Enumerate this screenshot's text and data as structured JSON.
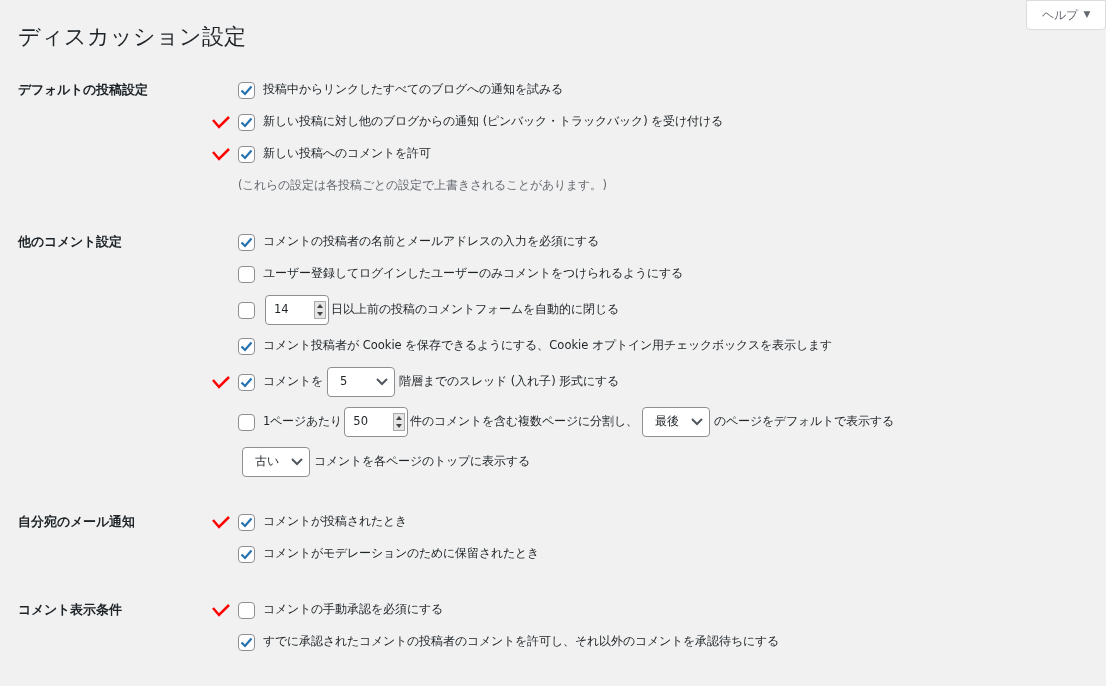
{
  "help_tab": {
    "label": "ヘルプ",
    "arrow": "▼"
  },
  "title": "ディスカッション設定",
  "sections": [
    {
      "label": "デフォルトの投稿設定",
      "rows": [
        {
          "kind": "checkbox",
          "checked": true,
          "marked": false,
          "parts": [
            {
              "kind": "text",
              "text": "投稿中からリンクしたすべてのブログへの通知を試みる"
            }
          ]
        },
        {
          "kind": "checkbox",
          "checked": true,
          "marked": true,
          "parts": [
            {
              "kind": "text",
              "text": "新しい投稿に対し他のブログからの通知 (ピンバック・トラックバック) を受け付ける"
            }
          ]
        },
        {
          "kind": "checkbox",
          "checked": true,
          "marked": true,
          "parts": [
            {
              "kind": "text",
              "text": "新しい投稿へのコメントを許可"
            }
          ]
        },
        {
          "kind": "note",
          "marked": false,
          "parts": [
            {
              "kind": "text",
              "text": "(これらの設定は各投稿ごとの設定で上書きされることがあります。)"
            }
          ]
        }
      ]
    },
    {
      "label": "他のコメント設定",
      "rows": [
        {
          "kind": "checkbox",
          "checked": true,
          "marked": false,
          "parts": [
            {
              "kind": "text",
              "text": "コメントの投稿者の名前とメールアドレスの入力を必須にする"
            }
          ]
        },
        {
          "kind": "checkbox",
          "checked": false,
          "marked": false,
          "parts": [
            {
              "kind": "text",
              "text": "ユーザー登録してログインしたユーザーのみコメントをつけられるようにする"
            }
          ]
        },
        {
          "kind": "checkbox",
          "checked": false,
          "marked": false,
          "parts": [
            {
              "kind": "number",
              "value": "14"
            },
            {
              "kind": "text",
              "text": "日以上前の投稿のコメントフォームを自動的に閉じる"
            }
          ]
        },
        {
          "kind": "checkbox",
          "checked": true,
          "marked": false,
          "parts": [
            {
              "kind": "text",
              "text": "コメント投稿者が Cookie を保存できるようにする、Cookie オプトイン用チェックボックスを表示します"
            }
          ]
        },
        {
          "kind": "checkbox",
          "checked": true,
          "marked": true,
          "parts": [
            {
              "kind": "text",
              "text": "コメントを"
            },
            {
              "kind": "select",
              "value": "5"
            },
            {
              "kind": "text",
              "text": "階層までのスレッド (入れ子) 形式にする"
            }
          ]
        },
        {
          "kind": "checkbox",
          "checked": false,
          "marked": false,
          "parts": [
            {
              "kind": "text",
              "text": "1ページあたり"
            },
            {
              "kind": "number",
              "value": "50"
            },
            {
              "kind": "text",
              "text": "件のコメントを含む複数ページに分割し、"
            },
            {
              "kind": "select",
              "value": "最後"
            },
            {
              "kind": "text",
              "text": "のページをデフォルトで表示する"
            }
          ]
        },
        {
          "kind": "plain",
          "marked": false,
          "parts": [
            {
              "kind": "select",
              "value": "古い"
            },
            {
              "kind": "text",
              "text": "コメントを各ページのトップに表示する"
            }
          ]
        }
      ]
    },
    {
      "label": "自分宛のメール通知",
      "rows": [
        {
          "kind": "checkbox",
          "checked": true,
          "marked": true,
          "parts": [
            {
              "kind": "text",
              "text": "コメントが投稿されたとき"
            }
          ]
        },
        {
          "kind": "checkbox",
          "checked": true,
          "marked": false,
          "parts": [
            {
              "kind": "text",
              "text": "コメントがモデレーションのために保留されたとき"
            }
          ]
        }
      ]
    },
    {
      "label": "コメント表示条件",
      "rows": [
        {
          "kind": "checkbox",
          "checked": false,
          "marked": true,
          "parts": [
            {
              "kind": "text",
              "text": "コメントの手動承認を必須にする"
            }
          ]
        },
        {
          "kind": "checkbox",
          "checked": true,
          "marked": false,
          "parts": [
            {
              "kind": "text",
              "text": "すでに承認されたコメントの投稿者のコメントを許可し、それ以外のコメントを承認待ちにする"
            }
          ]
        }
      ]
    }
  ]
}
